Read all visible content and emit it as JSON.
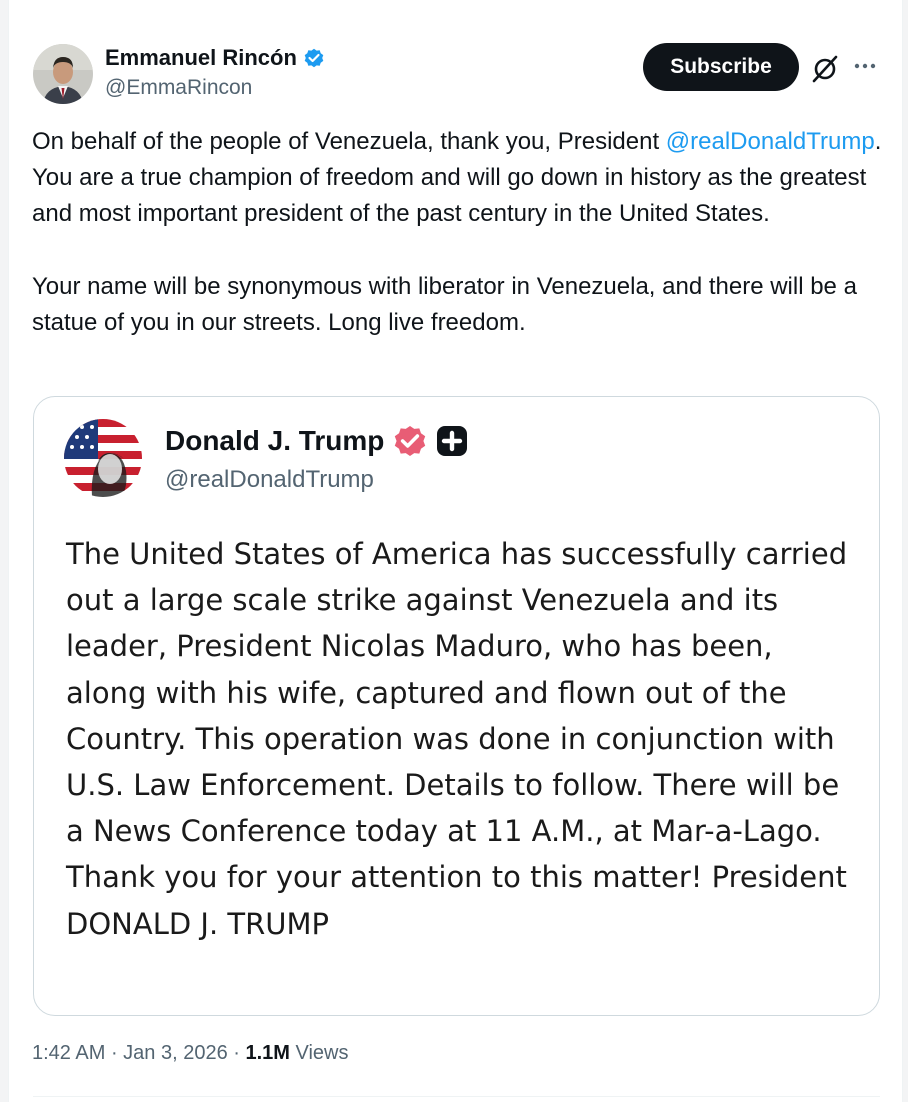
{
  "tweet": {
    "author": {
      "name": "Emmanuel Rincón",
      "handle": "@EmmaRincon"
    },
    "subscribe_label": "Subscribe",
    "body": {
      "p1_before": "On behalf of the people of Venezuela, thank you, President ",
      "p1_mention": "@realDonaldTrump",
      "p1_after": ". You are a true champion of freedom and will go down in history as the greatest and most important president of the past century in the United States.",
      "p2": "Your name will be synonymous with liberator in Venezuela, and there will be a statue of you in our streets. Long live freedom."
    },
    "quoted": {
      "name": "Donald J. Trump",
      "handle": "@realDonaldTrump",
      "text": "The United States of America has successfully carried out a large scale strike against Venezuela and its leader, President Nicolas Maduro, who has been, along with his wife, captured and flown out of the Country. This operation was done in conjunction with U.S. Law Enforcement. Details to follow. There will be a News Conference today at 11 A.M., at Mar-a-Lago. Thank you for your attention to this matter! President DONALD J. TRUMP"
    },
    "meta": {
      "time": "1:42 AM",
      "sep1": " · ",
      "date": "Jan 3, 2026",
      "sep2": " · ",
      "views_count": "1.1M",
      "views_label": " Views"
    }
  },
  "colors": {
    "link": "#1d9bf0",
    "verified_blue": "#1d9bf0",
    "verified_pink": "#e85d75",
    "secondary_text": "#536471"
  },
  "icons": {
    "verified": "verified-badge-icon",
    "truth_social_verified": "verified-badge-icon",
    "plus_badge": "plus-badge-icon",
    "grok": "grok-icon",
    "more": "more-icon"
  }
}
